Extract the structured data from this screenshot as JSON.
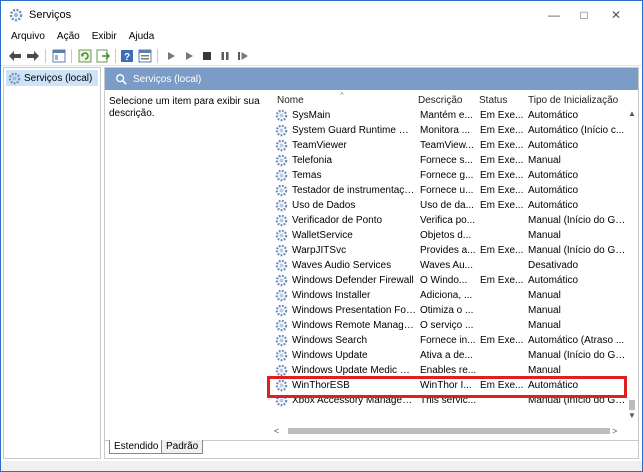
{
  "window": {
    "title": "Serviços"
  },
  "menu": [
    "Arquivo",
    "Ação",
    "Exibir",
    "Ajuda"
  ],
  "tree": {
    "item": "Serviços (local)"
  },
  "pane": {
    "header": "Serviços (local)",
    "description": "Selecione um item para exibir sua descrição."
  },
  "columns": {
    "name": "Nome",
    "desc": "Descrição",
    "status": "Status",
    "type": "Tipo de Inicialização"
  },
  "rows": [
    {
      "name": "SysMain",
      "desc": "Mantém e...",
      "status": "Em Exe...",
      "type": "Automático"
    },
    {
      "name": "System Guard Runtime Mo...",
      "desc": "Monitora ...",
      "status": "Em Exe...",
      "type": "Automático (Início c..."
    },
    {
      "name": "TeamViewer",
      "desc": "TeamView...",
      "status": "Em Exe...",
      "type": "Automático"
    },
    {
      "name": "Telefonia",
      "desc": "Fornece s...",
      "status": "Em Exe...",
      "type": "Manual"
    },
    {
      "name": "Temas",
      "desc": "Fornece g...",
      "status": "Em Exe...",
      "type": "Automático"
    },
    {
      "name": "Testador de instrumentação...",
      "desc": "Fornece u...",
      "status": "Em Exe...",
      "type": "Automático"
    },
    {
      "name": "Uso de Dados",
      "desc": "Uso de da...",
      "status": "Em Exe...",
      "type": "Automático"
    },
    {
      "name": "Verificador de Ponto",
      "desc": "Verifica po...",
      "status": "",
      "type": "Manual (Início do Ga..."
    },
    {
      "name": "WalletService",
      "desc": "Objetos d...",
      "status": "",
      "type": "Manual"
    },
    {
      "name": "WarpJITSvc",
      "desc": "Provides a...",
      "status": "Em Exe...",
      "type": "Manual (Início do Ga..."
    },
    {
      "name": "Waves Audio Services",
      "desc": "Waves Au...",
      "status": "",
      "type": "Desativado"
    },
    {
      "name": "Windows Defender Firewall",
      "desc": "O Windo...",
      "status": "Em Exe...",
      "type": "Automático"
    },
    {
      "name": "Windows Installer",
      "desc": "Adiciona, ...",
      "status": "",
      "type": "Manual"
    },
    {
      "name": "Windows Presentation Fou...",
      "desc": "Otimiza o ...",
      "status": "",
      "type": "Manual"
    },
    {
      "name": "Windows Remote Manage...",
      "desc": "O serviço ...",
      "status": "",
      "type": "Manual"
    },
    {
      "name": "Windows Search",
      "desc": "Fornece in...",
      "status": "Em Exe...",
      "type": "Automático (Atraso ..."
    },
    {
      "name": "Windows Update",
      "desc": "Ativa a de...",
      "status": "",
      "type": "Manual (Início do Ga..."
    },
    {
      "name": "Windows Update Medic Ser...",
      "desc": "Enables re...",
      "status": "",
      "type": "Manual"
    },
    {
      "name": "WinThorESB",
      "desc": "WinThor I...",
      "status": "Em Exe...",
      "type": "Automático"
    },
    {
      "name": "Xbox Accessory Manageme...",
      "desc": "This servic...",
      "status": "",
      "type": "Manual (Início do Ga..."
    }
  ],
  "tabs": {
    "extended": "Estendido",
    "standard": "Padrão"
  },
  "colors": {
    "header_bg": "#7a9cc6",
    "highlight": "#e02020",
    "selection": "#cde3f7"
  }
}
